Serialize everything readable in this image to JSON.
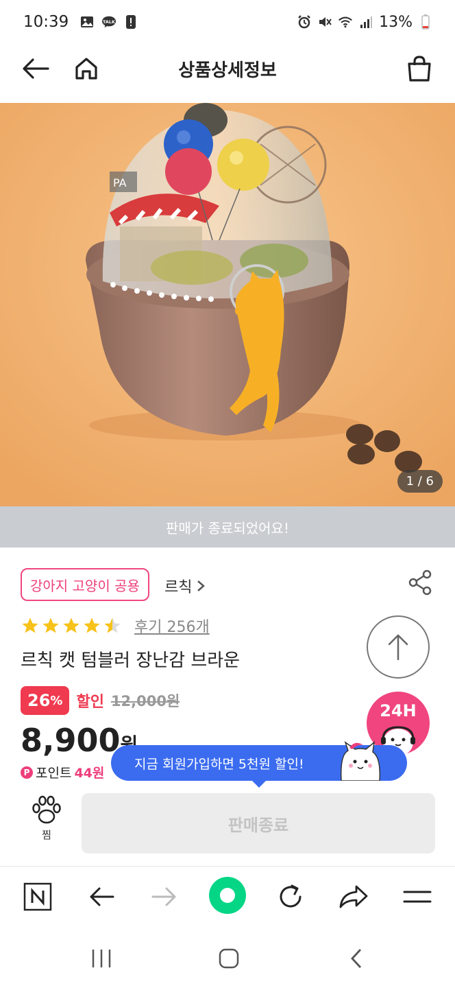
{
  "status_bar": {
    "time": "10:39",
    "left_icons": [
      "gallery-icon",
      "kakaotalk-icon",
      "alert-icon"
    ],
    "right_icons": [
      "alarm-icon",
      "mute-icon",
      "wifi-icon",
      "signal-icon",
      "battery-icon"
    ],
    "battery": "13%"
  },
  "header": {
    "title": "상품상세정보",
    "icons": [
      "back-arrow-icon",
      "home-icon",
      "shopping-bag-icon"
    ]
  },
  "product_image": {
    "counter": "1 / 6",
    "sold_banner": "판매가 종료되었어요!"
  },
  "product": {
    "tag": "강아지 고양이 공용",
    "brand": "르칙",
    "rating": 4.5,
    "rating_max": 5,
    "review_link": "후기 256개",
    "title": "르칙 캣 텀블러 장난감 브라운",
    "discount_percent": "26",
    "discount_sign": "%",
    "discount_label": "할인",
    "original_price": "12,000원",
    "price": "8,900",
    "price_unit": "원",
    "points_label": "포인트",
    "points_value": "44원",
    "p_icon_letter": "P"
  },
  "cs_badge": {
    "label": "24H"
  },
  "promo_tooltip": {
    "text": "지금 회원가입하면 5천원 할인!"
  },
  "actions": {
    "wish_label": "찜",
    "soldout_label": "판매종료"
  },
  "browser_toolbar": {
    "buttons": [
      "naver-icon",
      "back-icon",
      "forward-icon",
      "green-dot-icon",
      "refresh-icon",
      "share-icon",
      "menu-icon"
    ]
  },
  "system_nav": {
    "buttons": [
      "recent-apps-icon",
      "home-icon",
      "back-icon"
    ]
  },
  "colors": {
    "accent_pink": "#ee3e7b",
    "discount_red": "#ef3a4f",
    "tooltip_blue": "#3b6cf0",
    "banner_gray": "#c9cdd1",
    "star_yellow": "#f7c21a"
  }
}
